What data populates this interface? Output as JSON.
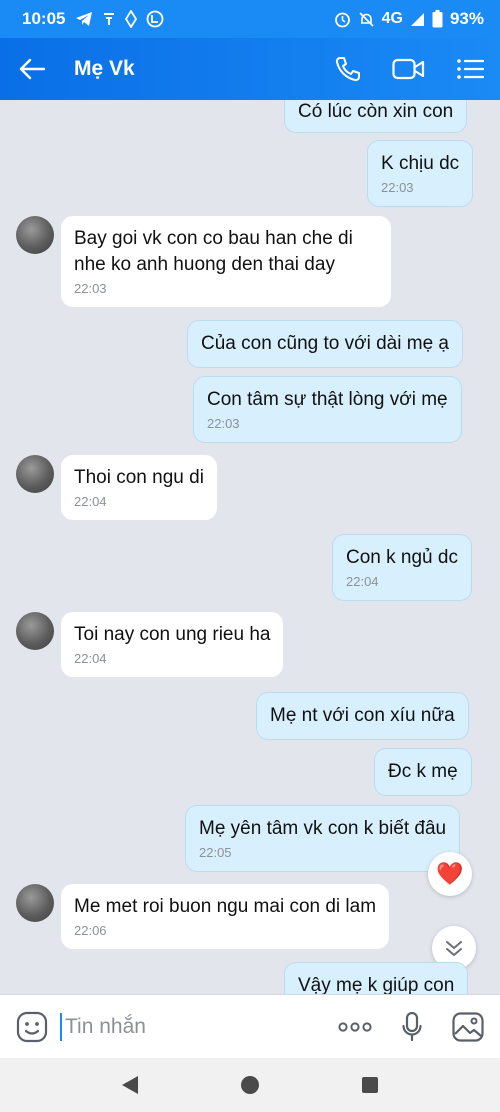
{
  "status_bar": {
    "time": "10:05",
    "network": "4G",
    "battery": "93%"
  },
  "header": {
    "title": "Mẹ Vk"
  },
  "messages": [
    {
      "text": "Có lúc còn xin con",
      "time": ""
    },
    {
      "text": "K chịu dc",
      "time": "22:03"
    },
    {
      "text": "Bay goi vk con co bau han che di nhe ko anh huong den thai day",
      "time": "22:03"
    },
    {
      "text": "Của con cũng to với dài mẹ ạ",
      "time": ""
    },
    {
      "text": "Con tâm sự thật lòng với mẹ",
      "time": "22:03"
    },
    {
      "text": "Thoi con ngu di",
      "time": "22:04"
    },
    {
      "text": "Con k ngủ dc",
      "time": "22:04"
    },
    {
      "text": "Toi nay con ung rieu ha",
      "time": "22:04"
    },
    {
      "text": "Mẹ nt với con xíu nữa",
      "time": ""
    },
    {
      "text": "Đc k mẹ",
      "time": ""
    },
    {
      "text": "Mẹ yên tâm vk con k biết đâu",
      "time": "22:05"
    },
    {
      "text": "Me met roi buon ngu mai con di lam",
      "time": "22:06"
    },
    {
      "text": "Vậy mẹ k giúp con",
      "time": ""
    }
  ],
  "reaction": "❤️",
  "input": {
    "placeholder": "Tin nhắn"
  },
  "colors": {
    "accent": "#1a8af5",
    "outgoing_bubble": "#d8f0fd",
    "incoming_bubble": "#ffffff",
    "background": "#e2e6ec"
  },
  "icons": {
    "status": [
      "telegram-icon",
      "wifi-icon",
      "signal-icon",
      "vpn-icon",
      "alarm-icon",
      "mute-icon",
      "cell-signal-icon",
      "battery-icon"
    ],
    "header": [
      "back-arrow-icon",
      "phone-icon",
      "video-call-icon",
      "menu-icon"
    ],
    "input": [
      "sticker-icon",
      "more-icon",
      "microphone-icon",
      "image-icon"
    ],
    "nav": [
      "back-nav-icon",
      "home-nav-icon",
      "recents-nav-icon"
    ]
  }
}
